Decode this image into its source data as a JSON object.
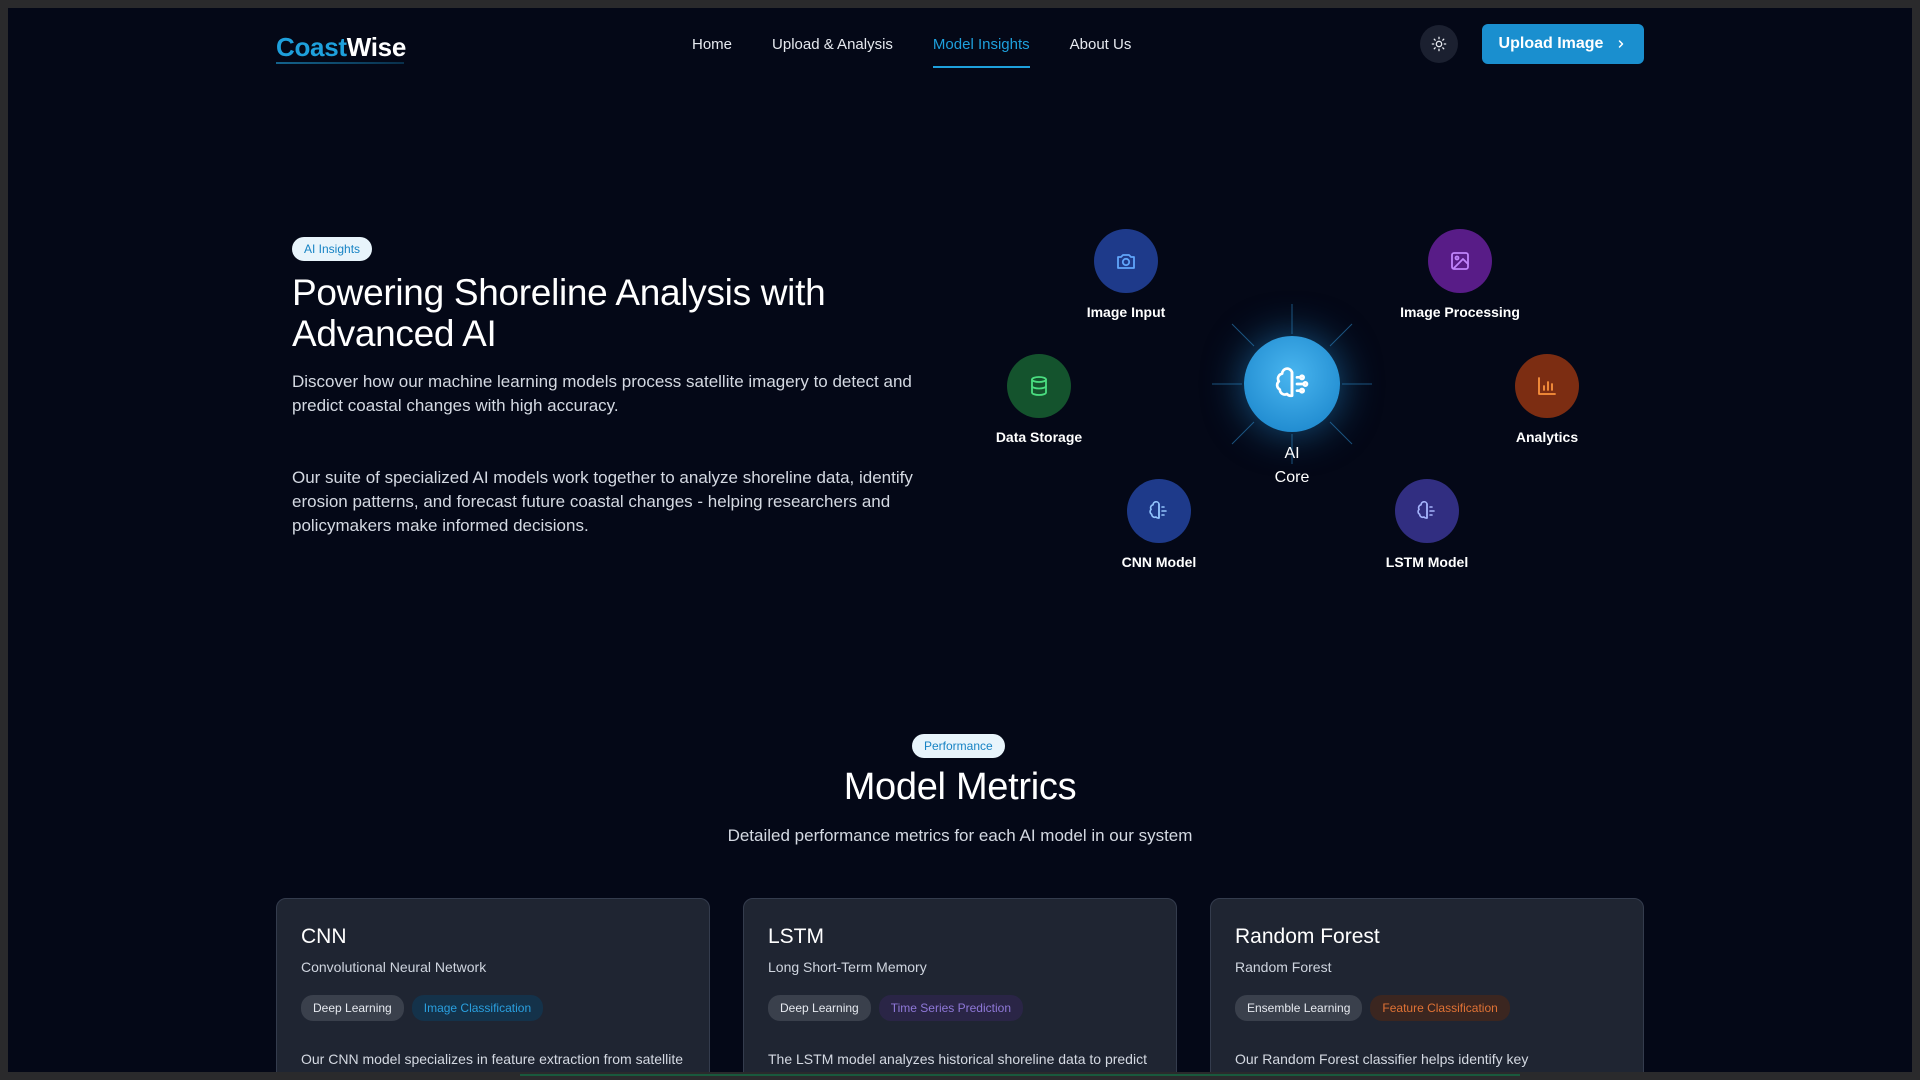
{
  "nav": {
    "logo_part1": "Coast",
    "logo_part2": "Wise",
    "links": [
      {
        "label": "Home",
        "active": false
      },
      {
        "label": "Upload & Analysis",
        "active": false
      },
      {
        "label": "Model Insights",
        "active": true
      },
      {
        "label": "About Us",
        "active": false
      }
    ],
    "theme_icon": "sun-icon",
    "upload_label": "Upload Image"
  },
  "hero": {
    "badge": "AI Insights",
    "title": "Powering Shoreline Analysis with Advanced AI",
    "subtitle": "Discover how our machine learning models process satellite imagery to detect and predict coastal changes with high accuracy.",
    "description": "Our suite of specialized AI models work together to analyze shoreline data, identify erosion patterns, and forecast future coastal changes - helping researchers and policymakers make informed decisions."
  },
  "diagram": {
    "core": {
      "label_line1": "AI",
      "label_line2": "Core",
      "icon": "brain-icon"
    },
    "nodes": [
      {
        "id": "image-input",
        "label": "Image Input",
        "icon": "camera-icon",
        "color": "#1e3a8a"
      },
      {
        "id": "image-processing",
        "label": "Image Processing",
        "icon": "image-icon",
        "color": "#581c87"
      },
      {
        "id": "data-storage",
        "label": "Data Storage",
        "icon": "database-icon",
        "color": "#14532d"
      },
      {
        "id": "analytics",
        "label": "Analytics",
        "icon": "bar-chart-icon",
        "color": "#7c2d12"
      },
      {
        "id": "cnn-model",
        "label": "CNN Model",
        "icon": "brain-icon",
        "color": "#1e3a8a"
      },
      {
        "id": "lstm-model",
        "label": "LSTM Model",
        "icon": "brain-icon",
        "color": "#312e81"
      }
    ]
  },
  "metrics": {
    "badge": "Performance",
    "title": "Model Metrics",
    "subtitle": "Detailed performance metrics for each AI model in our system",
    "cards": [
      {
        "name": "CNN",
        "full_name": "Convolutional Neural Network",
        "tags": [
          {
            "label": "Deep Learning",
            "style": "neutral"
          },
          {
            "label": "Image Classification",
            "style": "blue"
          }
        ],
        "description": "Our CNN model specializes in feature extraction from satellite imagery, identifying shoreline boundaries with"
      },
      {
        "name": "LSTM",
        "full_name": "Long Short-Term Memory",
        "tags": [
          {
            "label": "Deep Learning",
            "style": "neutral"
          },
          {
            "label": "Time Series Prediction",
            "style": "purple"
          }
        ],
        "description": "The LSTM model analyzes historical shoreline data to predict future changes and erosion patterns over time"
      },
      {
        "name": "Random Forest",
        "full_name": "Random Forest",
        "tags": [
          {
            "label": "Ensemble Learning",
            "style": "neutral"
          },
          {
            "label": "Feature Classification",
            "style": "orange"
          }
        ],
        "description": "Our Random Forest classifier helps identify key environmental factors contributing to shoreline changes"
      }
    ]
  }
}
